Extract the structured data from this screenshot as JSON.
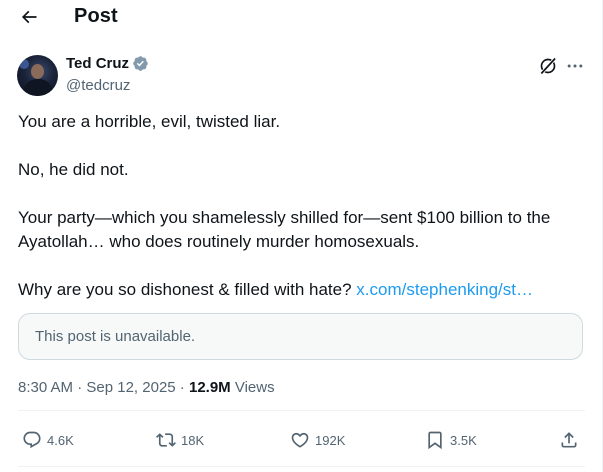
{
  "header": {
    "title": "Post"
  },
  "author": {
    "name": "Ted Cruz",
    "handle": "@tedcruz"
  },
  "post": {
    "line1": "You are a horrible, evil, twisted liar.",
    "line2": "No, he did not.",
    "line3": "Your party—which you shamelessly shilled for—sent $100 billion to the Ayatollah… who does routinely murder homosexuals.",
    "line4_text": "Why are you so dishonest & filled with hate? ",
    "line4_link": "x.com/stephenking/st…"
  },
  "quote": {
    "unavailable_text": "This post is unavailable."
  },
  "meta": {
    "time": "8:30 AM",
    "separator": " · ",
    "date": "Sep 12, 2025",
    "separator2": " · ",
    "views_count": "12.9M",
    "views_label": " Views"
  },
  "actions": {
    "replies": "4.6K",
    "reposts": "18K",
    "likes": "192K",
    "bookmarks": "3.5K"
  },
  "colors": {
    "text": "#0f1419",
    "secondary": "#536471",
    "link": "#1d9bf0",
    "verified": "#829aab",
    "border": "#cfd9de"
  },
  "icons": [
    "back-arrow-icon",
    "verified-badge-icon",
    "grok-icon",
    "more-icon",
    "reply-icon",
    "repost-icon",
    "like-icon",
    "bookmark-icon",
    "share-icon"
  ]
}
